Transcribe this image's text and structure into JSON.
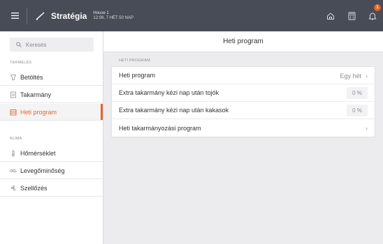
{
  "topbar": {
    "title": "Stratégia",
    "house_name": "House 1",
    "house_info": "12:08, 7 HÉT 50 NAP",
    "notification_count": "1"
  },
  "sidebar": {
    "search_placeholder": "Keresés",
    "section_production": "TERMELÉS",
    "section_climate": "KLÍMA",
    "items": [
      {
        "label": "Betöltés",
        "icon": "silo-icon"
      },
      {
        "label": "Takarmány",
        "icon": "feed-icon"
      },
      {
        "label": "Heti program",
        "icon": "calendar-icon",
        "active": true
      },
      {
        "label": "Hőmérséklet",
        "icon": "thermometer-icon"
      },
      {
        "label": "Levegőminőség",
        "icon": "co2-icon"
      },
      {
        "label": "Szellőzés",
        "icon": "fan-icon"
      }
    ]
  },
  "main": {
    "title": "Heti program",
    "section_label": "HETI PROGRAM",
    "rows": [
      {
        "label": "Heti program",
        "value": "Egy hét"
      },
      {
        "label": "Extra takarmány kézi nap után tojók",
        "value": "0 %"
      },
      {
        "label": "Extra takarmány kézi nap után kakasok",
        "value": "0 %"
      },
      {
        "label": "Heti takarmányozási program",
        "value": ""
      }
    ]
  },
  "colors": {
    "topbar_bg": "#474c56",
    "accent": "#e5622a",
    "page_bg": "#ececee"
  }
}
